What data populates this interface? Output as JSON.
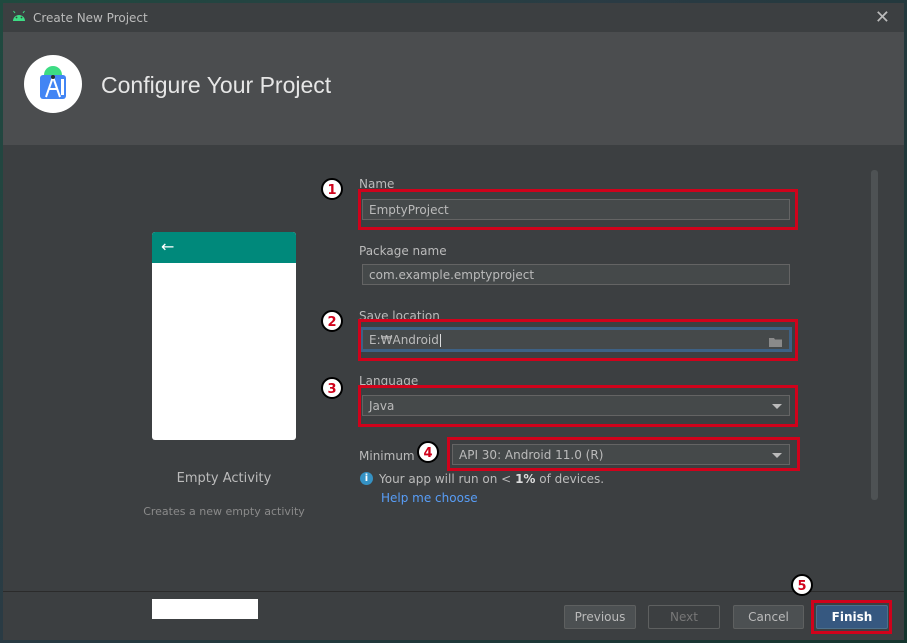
{
  "window": {
    "title": "Create New Project",
    "close_glyph": "✕"
  },
  "header": {
    "title": "Configure Your Project",
    "logo_icon": "android-studio-logo"
  },
  "template": {
    "name": "Empty Activity",
    "description": "Creates a new empty activity",
    "back_glyph": "←",
    "accent": "#00897b"
  },
  "form": {
    "name": {
      "label": "Name",
      "value": "EmptyProject"
    },
    "package": {
      "label": "Package name",
      "value": "com.example.emptyproject"
    },
    "save_location": {
      "label": "Save location",
      "value": "E:₩Android",
      "icon": "folder-icon"
    },
    "language": {
      "label": "Language",
      "value": "Java"
    },
    "minimum": {
      "label": "Minimum",
      "value": "API 30: Android 11.0 (R)"
    },
    "info": {
      "prefix": "Your app will run on < ",
      "bold": "1%",
      "suffix": " of devices.",
      "icon": "i"
    },
    "help_link": "Help me choose"
  },
  "annotations": {
    "badges": [
      "1",
      "2",
      "3",
      "4",
      "5"
    ],
    "color": "#d0021b"
  },
  "footer": {
    "previous": "Previous",
    "next": "Next",
    "cancel": "Cancel",
    "finish": "Finish"
  }
}
